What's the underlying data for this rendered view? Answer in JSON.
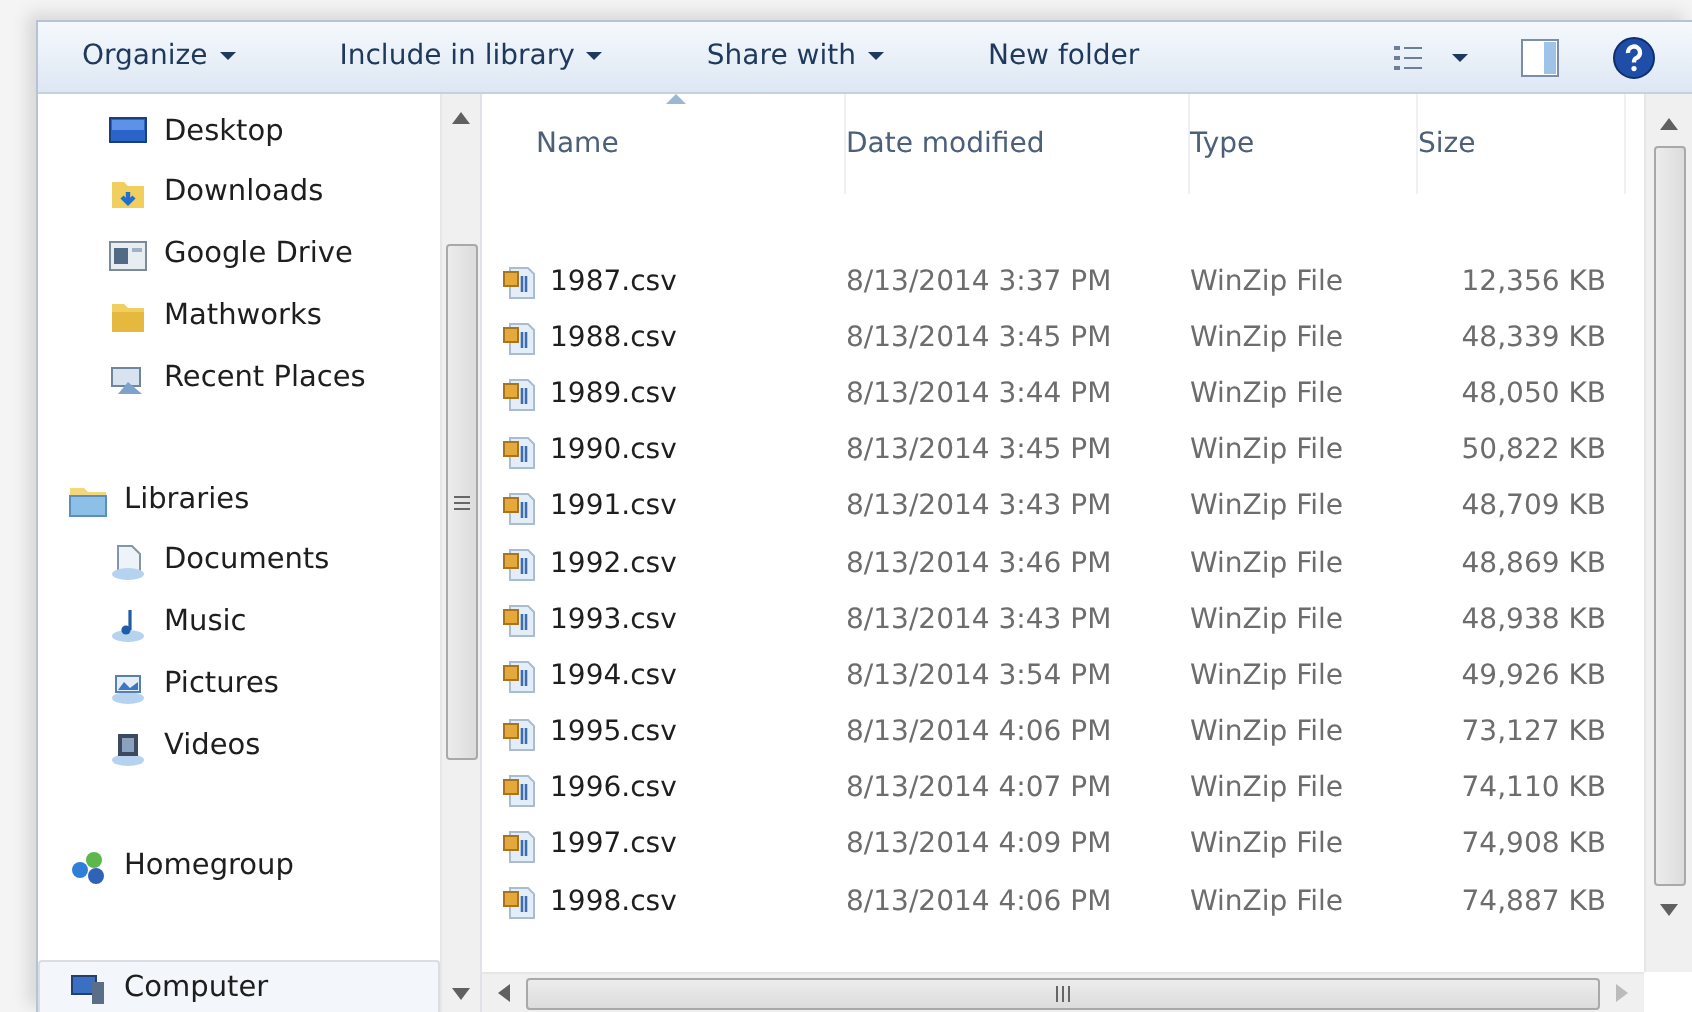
{
  "toolbar": {
    "menus": [
      {
        "label": "Organize",
        "dropdown": true
      },
      {
        "label": "Include in library",
        "dropdown": true
      },
      {
        "label": "Share with",
        "dropdown": true
      },
      {
        "label": "New folder",
        "dropdown": false
      }
    ]
  },
  "sidebar": {
    "groups": [
      {
        "children": [
          {
            "label": "Desktop",
            "selected": false
          },
          {
            "label": "Downloads",
            "selected": false
          },
          {
            "label": "Google Drive",
            "selected": false
          },
          {
            "label": "Mathworks",
            "selected": false
          },
          {
            "label": "Recent Places",
            "selected": false
          }
        ]
      },
      {
        "label": "Libraries",
        "selected": false,
        "children": [
          {
            "label": "Documents",
            "selected": false
          },
          {
            "label": "Music",
            "selected": false
          },
          {
            "label": "Pictures",
            "selected": false
          },
          {
            "label": "Videos",
            "selected": false
          }
        ]
      },
      {
        "label": "Homegroup",
        "selected": false
      },
      {
        "label": "Computer",
        "selected": true
      }
    ]
  },
  "table": {
    "columns": [
      {
        "label": "Name",
        "sorted": true
      },
      {
        "label": "Date modified",
        "sorted": false
      },
      {
        "label": "Type",
        "sorted": false
      },
      {
        "label": "Size",
        "sorted": false
      }
    ],
    "rows": [
      [
        "1987.csv",
        "8/13/2014 3:37 PM",
        "WinZip File",
        "12,356 KB"
      ],
      [
        "1988.csv",
        "8/13/2014 3:45 PM",
        "WinZip File",
        "48,339 KB"
      ],
      [
        "1989.csv",
        "8/13/2014 3:44 PM",
        "WinZip File",
        "48,050 KB"
      ],
      [
        "1990.csv",
        "8/13/2014 3:45 PM",
        "WinZip File",
        "50,822 KB"
      ],
      [
        "1991.csv",
        "8/13/2014 3:43 PM",
        "WinZip File",
        "48,709 KB"
      ],
      [
        "1992.csv",
        "8/13/2014 3:46 PM",
        "WinZip File",
        "48,869 KB"
      ],
      [
        "1993.csv",
        "8/13/2014 3:43 PM",
        "WinZip File",
        "48,938 KB"
      ],
      [
        "1994.csv",
        "8/13/2014 3:54 PM",
        "WinZip File",
        "49,926 KB"
      ],
      [
        "1995.csv",
        "8/13/2014 4:06 PM",
        "WinZip File",
        "73,127 KB"
      ],
      [
        "1996.csv",
        "8/13/2014 4:07 PM",
        "WinZip File",
        "74,110 KB"
      ],
      [
        "1997.csv",
        "8/13/2014 4:09 PM",
        "WinZip File",
        "74,908 KB"
      ],
      [
        "1998.csv",
        "8/13/2014 4:06 PM",
        "WinZip File",
        "74,887 KB"
      ]
    ]
  }
}
